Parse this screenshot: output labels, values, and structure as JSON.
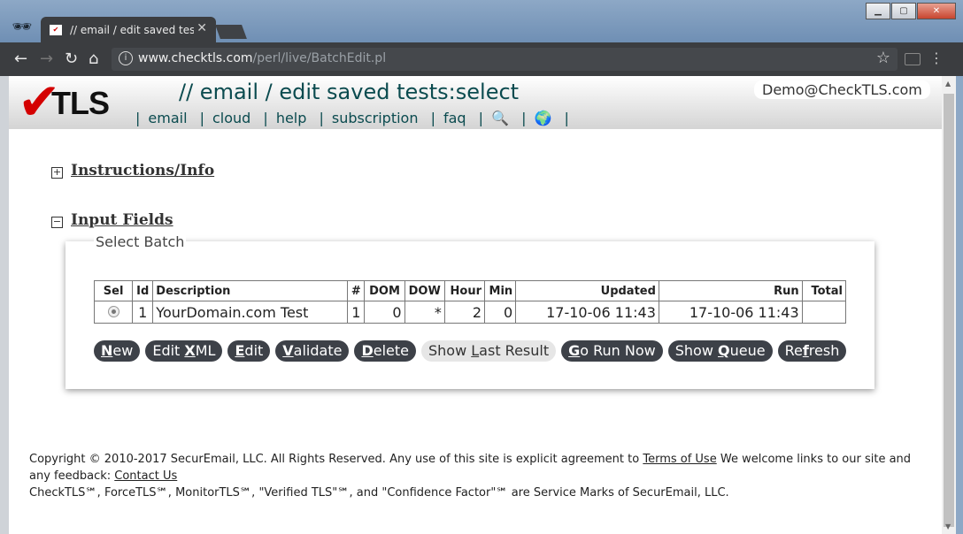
{
  "browser": {
    "tab_title": "// email / edit saved test",
    "url_host": "www.checktls.com",
    "url_path": "/perl/live/BatchEdit.pl"
  },
  "header": {
    "logo_text": "TLS",
    "title": "// email / edit saved tests:select",
    "user": "Demo@CheckTLS.com",
    "nav": [
      "email",
      "cloud",
      "help",
      "subscription",
      "faq"
    ]
  },
  "sections": {
    "instructions": "Instructions/Info",
    "input_fields": "Input Fields",
    "select_batch": "Select Batch"
  },
  "table": {
    "headers": [
      "Sel",
      "Id",
      "Description",
      "#",
      "DOM",
      "DOW",
      "Hour",
      "Min",
      "Updated",
      "Run",
      "Total"
    ],
    "rows": [
      {
        "id": "1",
        "description": "YourDomain.com Test",
        "num": "1",
        "dom": "0",
        "dow": "*",
        "hour": "2",
        "min": "0",
        "updated": "17-10-06 11:43",
        "run": "17-10-06 11:43",
        "total": ""
      }
    ]
  },
  "buttons": {
    "new": {
      "a": "N",
      "b": "ew"
    },
    "edit_xml": {
      "a": "Edit ",
      "u": "X",
      "b": "ML"
    },
    "edit": {
      "u": "E",
      "b": "dit"
    },
    "validate": {
      "u": "V",
      "b": "alidate"
    },
    "delete": {
      "u": "D",
      "b": "elete"
    },
    "show_last": {
      "a": "Show ",
      "u": "L",
      "b": "ast Result"
    },
    "go_run": {
      "u": "G",
      "b": "o Run Now"
    },
    "show_queue": {
      "a": "Show ",
      "u": "Q",
      "b": "ueue"
    },
    "refresh": {
      "a": "Re",
      "u": "f",
      "b": "resh"
    }
  },
  "footer": {
    "copyright": "Copyright © 2010-2017 SecurEmail, LLC. All Rights Reserved. Any use of this site is explicit agreement to ",
    "terms": "Terms of Use",
    "welcome": " We welcome links to our site and any feedback: ",
    "contact": "Contact Us",
    "marks": "CheckTLS℠, ForceTLS℠, MonitorTLS℠, \"Verified TLS\"℠, and \"Confidence Factor\"℠ are Service Marks of SecurEmail, LLC."
  }
}
